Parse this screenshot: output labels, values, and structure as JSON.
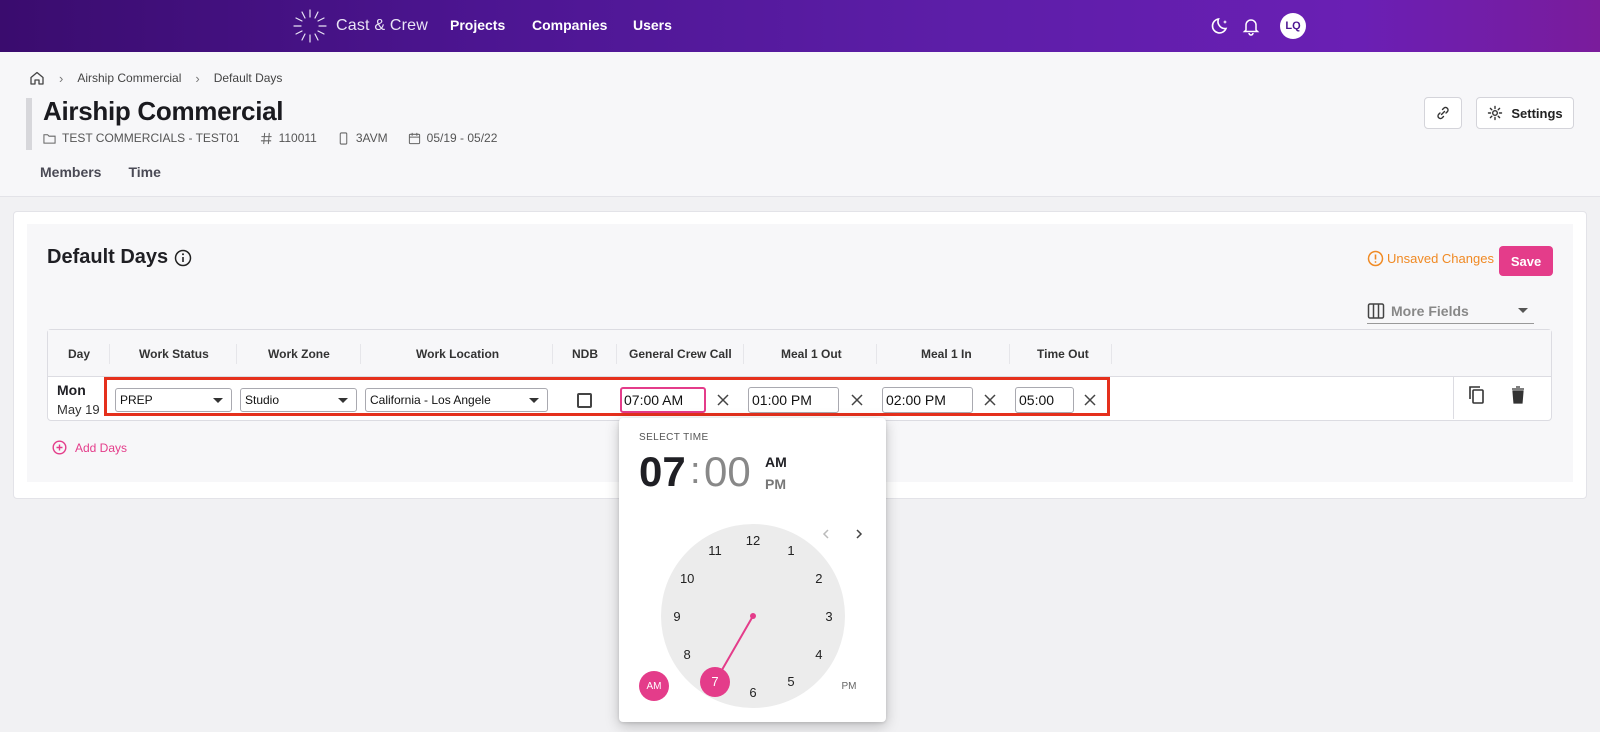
{
  "app": {
    "brand": "Cast & Crew"
  },
  "topnav": {
    "projects": "Projects",
    "companies": "Companies",
    "users": "Users",
    "avatar_initials": "LQ"
  },
  "breadcrumb": {
    "items": [
      "Airship Commercial",
      "Default Days"
    ]
  },
  "project": {
    "title": "Airship Commercial",
    "company": "TEST COMMERCIALS - TEST01",
    "number": "110011",
    "code": "3AVM",
    "dates": "05/19 - 05/22"
  },
  "header_buttons": {
    "settings": "Settings"
  },
  "tabs": [
    "Members",
    "Time"
  ],
  "section": {
    "title": "Default Days",
    "unsaved": "Unsaved Changes",
    "save": "Save",
    "more_fields": "More Fields",
    "add_days": "Add Days"
  },
  "table": {
    "columns": [
      "Day",
      "Work Status",
      "Work Zone",
      "Work Location",
      "NDB",
      "General Crew Call",
      "Meal 1 Out",
      "Meal 1 In",
      "Time Out"
    ],
    "row": {
      "day": "Mon",
      "date": "May 19",
      "work_status": "PREP",
      "work_zone": "Studio",
      "work_location": "California - Los Angele",
      "ndb_checked": false,
      "general_crew_call": "07:00 AM",
      "meal1_out": "01:00 PM",
      "meal1_in": "02:00 PM",
      "time_out": "05:00"
    }
  },
  "time_picker": {
    "label": "SELECT TIME",
    "hour": "07",
    "colon": ":",
    "minute": "00",
    "am": "AM",
    "pm": "PM",
    "selected_hour": "7",
    "numbers": [
      "12",
      "1",
      "2",
      "3",
      "4",
      "5",
      "6",
      "7",
      "8",
      "9",
      "10",
      "11"
    ],
    "am_button": "AM",
    "pm_button": "PM"
  },
  "colors": {
    "accent": "#e43c8a",
    "warning": "#f08a24",
    "highlight": "#e5301c",
    "topbar_start": "#3a0c6e",
    "topbar_end": "#7a1c9c"
  }
}
